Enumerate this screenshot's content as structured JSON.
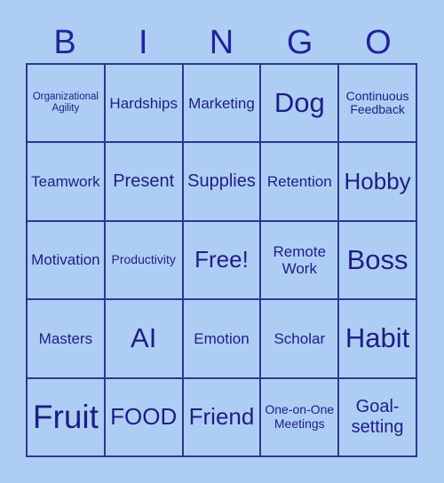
{
  "card": {
    "header_letters": [
      "B",
      "I",
      "N",
      "G",
      "O"
    ],
    "colors": {
      "background": "#aecdf5",
      "cell_background": "#aecdf5",
      "border": "#2a3a8c",
      "text": "#1e1e82",
      "header_text": "#232399"
    },
    "rows": [
      [
        {
          "label": "Organizational Agility",
          "size": "xs"
        },
        {
          "label": "Hardships",
          "size": "m"
        },
        {
          "label": "Marketing",
          "size": "m"
        },
        {
          "label": "Dog",
          "size": "xxl"
        },
        {
          "label": "Continuous Feedback",
          "size": "s"
        }
      ],
      [
        {
          "label": "Teamwork",
          "size": "m"
        },
        {
          "label": "Present",
          "size": "l"
        },
        {
          "label": "Supplies",
          "size": "l"
        },
        {
          "label": "Retention",
          "size": "m"
        },
        {
          "label": "Hobby",
          "size": "xl"
        }
      ],
      [
        {
          "label": "Motivation",
          "size": "m"
        },
        {
          "label": "Productivity",
          "size": "s"
        },
        {
          "label": "Free!",
          "size": "xl"
        },
        {
          "label": "Remote Work",
          "size": "m"
        },
        {
          "label": "Boss",
          "size": "xxl"
        }
      ],
      [
        {
          "label": "Masters",
          "size": "m"
        },
        {
          "label": "AI",
          "size": "xxl"
        },
        {
          "label": "Emotion",
          "size": "m"
        },
        {
          "label": "Scholar",
          "size": "m"
        },
        {
          "label": "Habit",
          "size": "xxl"
        }
      ],
      [
        {
          "label": "Fruit",
          "size": "huge"
        },
        {
          "label": "FOOD",
          "size": "xl"
        },
        {
          "label": "Friend",
          "size": "xl"
        },
        {
          "label": "One-on-One Meetings",
          "size": "s"
        },
        {
          "label": "Goal-setting",
          "size": "l"
        }
      ]
    ]
  }
}
